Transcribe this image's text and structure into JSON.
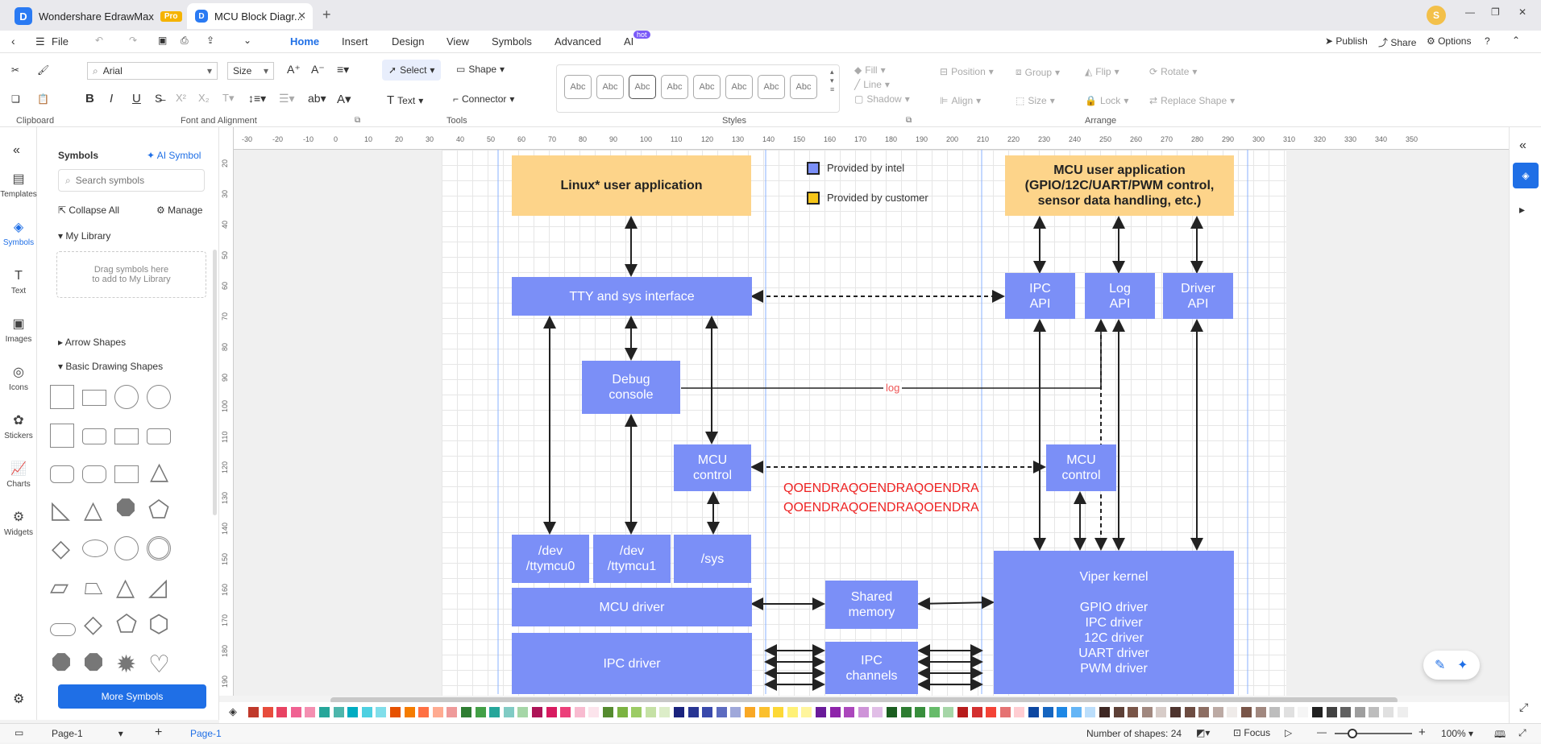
{
  "app": {
    "name": "Wondershare EdrawMax",
    "badge": "Pro",
    "tab": "MCU Block Diagr...",
    "user_initial": "S"
  },
  "menu": {
    "file": "File",
    "items": [
      "Home",
      "Insert",
      "Design",
      "View",
      "Symbols",
      "Advanced",
      "AI"
    ],
    "ai_badge": "hot",
    "publish": "Publish",
    "share": "Share",
    "options": "Options"
  },
  "ribbon": {
    "font": "Arial",
    "size": "Size",
    "select": "Select",
    "shape": "Shape",
    "text": "Text",
    "connector": "Connector",
    "styles": [
      "Abc",
      "Abc",
      "Abc",
      "Abc",
      "Abc",
      "Abc",
      "Abc",
      "Abc"
    ],
    "fill": "Fill",
    "line": "Line",
    "shadow": "Shadow",
    "position": "Position",
    "group": "Group",
    "flip": "Flip",
    "rotate": "Rotate",
    "align": "Align",
    "lock": "Lock",
    "replace": "Replace Shape",
    "groups": {
      "clipboard": "Clipboard",
      "font": "Font and Alignment",
      "tools": "Tools",
      "styles": "Styles",
      "arrange": "Arrange"
    }
  },
  "leftbar": [
    "Templates",
    "Symbols",
    "Text",
    "Images",
    "Icons",
    "Stickers",
    "Charts",
    "Widgets"
  ],
  "symbols": {
    "title": "Symbols",
    "ai": "AI Symbol",
    "search_placeholder": "Search symbols",
    "collapse": "Collapse All",
    "manage": "Manage",
    "my_library": "My Library",
    "drag_hint": "Drag symbols here\nto add to My Library",
    "arrow_shapes": "Arrow Shapes",
    "basic": "Basic Drawing Shapes",
    "more": "More Symbols"
  },
  "ruler_top": [
    "-30",
    "-20",
    "-10",
    "0",
    "10",
    "20",
    "30",
    "40",
    "50",
    "60",
    "70",
    "80",
    "90",
    "100",
    "110",
    "120",
    "130",
    "140",
    "150",
    "160",
    "170",
    "180",
    "190",
    "200",
    "210",
    "220",
    "230",
    "240",
    "250",
    "260",
    "270",
    "280",
    "290",
    "300",
    "310",
    "320",
    "330",
    "340",
    "350"
  ],
  "ruler_left": [
    "20",
    "30",
    "40",
    "50",
    "60",
    "70",
    "80",
    "90",
    "100",
    "110",
    "120",
    "130",
    "140",
    "150",
    "160",
    "170",
    "180",
    "190"
  ],
  "diagram": {
    "linux_app": "Linux* user application",
    "legend_intel": "Provided by intel",
    "legend_customer": "Provided by customer",
    "mcu_app": "MCU user application\n(GPIO/12C/UART/PWM control,\nsensor data handling, etc.)",
    "tty": "TTY and sys interface",
    "ipc_api": "IPC\nAPI",
    "log_api": "Log\nAPI",
    "driver_api": "Driver\nAPI",
    "debug": "Debug\nconsole",
    "log_label": "log",
    "mcu_control_left": "MCU\ncontrol",
    "mcu_control_right": "MCU\ncontrol",
    "watermark_1": "QOENDRAQOENDRAQOENDRA",
    "watermark_2": "QOENDRAQOENDRAQOENDRA",
    "dev0": "/dev\n/ttymcu0",
    "dev1": "/dev\n/ttymcu1",
    "sys": "/sys",
    "mcu_driver": "MCU driver",
    "shared": "Shared\nmemory",
    "viper": "Viper kernel\n\nGPIO driver\nIPC driver\n12C driver\nUART driver\nPWM driver",
    "ipc_driver": "IPC driver",
    "ipc_channels": "IPC\nchannels"
  },
  "colors": {
    "accent": "#1f6fe6",
    "block": "#7b8ff7",
    "yellow": "#fdd48a",
    "intel_swatch": "#7b8ff7",
    "customer_swatch": "#f5c518"
  },
  "status": {
    "page_tab": "Page-1",
    "page_active": "Page-1",
    "shapes": "Number of shapes: 24",
    "focus": "Focus",
    "zoom": "100%"
  }
}
